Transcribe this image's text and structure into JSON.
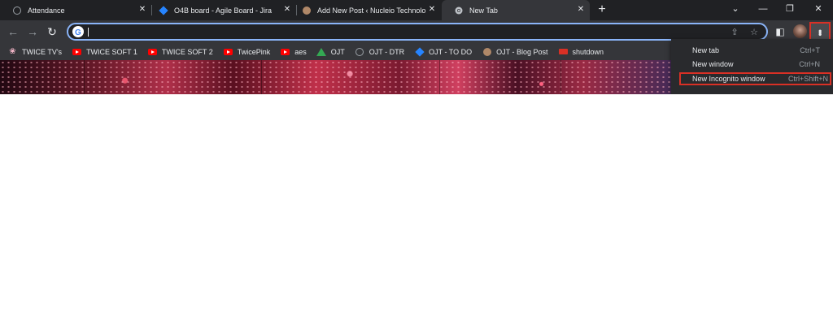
{
  "tabs": [
    {
      "title": "Attendance",
      "icon": "globe-icon"
    },
    {
      "title": "O4B board - Agile Board - Jira",
      "icon": "jira-icon"
    },
    {
      "title": "Add New Post ‹ Nucleio Technolo",
      "icon": "blog-icon"
    },
    {
      "title": "New Tab",
      "icon": "chrome-icon",
      "active": true
    }
  ],
  "toolbar": {
    "omnibox_value": ""
  },
  "bookmarks": [
    {
      "label": "TWICE TV's",
      "icon": "twice-icon"
    },
    {
      "label": "TWICE SOFT 1",
      "icon": "youtube-icon"
    },
    {
      "label": "TWICE SOFT 2",
      "icon": "youtube-icon"
    },
    {
      "label": "TwicePink",
      "icon": "youtube-icon"
    },
    {
      "label": "aes",
      "icon": "youtube-icon"
    },
    {
      "label": "OJT",
      "icon": "drive-icon"
    },
    {
      "label": "OJT - DTR",
      "icon": "globe-icon"
    },
    {
      "label": "OJT - TO DO",
      "icon": "jira-icon"
    },
    {
      "label": "OJT - Blog Post",
      "icon": "blog-icon"
    },
    {
      "label": "shutdown",
      "icon": "shutdown-icon"
    }
  ],
  "menu": {
    "items": [
      {
        "label": "New tab",
        "shortcut": "Ctrl+T"
      },
      {
        "label": "New window",
        "shortcut": "Ctrl+N"
      },
      {
        "label": "New Incognito window",
        "shortcut": "Ctrl+Shift+N",
        "highlighted": true
      }
    ]
  },
  "colors": {
    "tabstrip": "#202124",
    "toolbar": "#35363a",
    "omnibox_border": "#8ab4f8",
    "highlight": "#d93025"
  }
}
